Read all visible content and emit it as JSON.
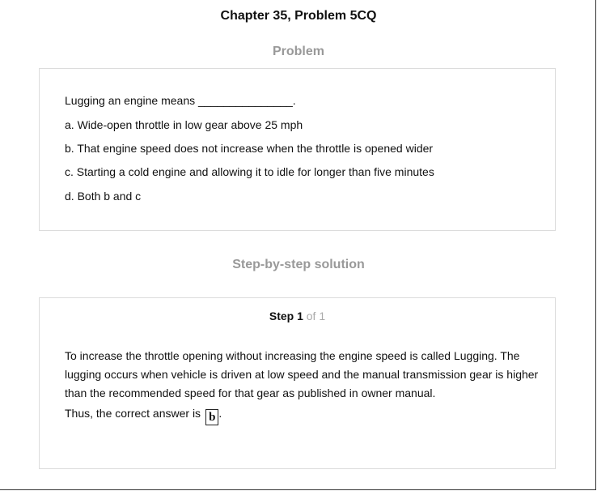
{
  "header": {
    "title": "Chapter 35, Problem 5CQ"
  },
  "problem": {
    "heading": "Problem",
    "question": "Lugging an engine means _______________.",
    "options": [
      "a. Wide-open throttle in low gear above 25 mph",
      "b. That engine speed does not increase when the throttle is opened wider",
      "c. Starting a cold engine and allowing it to idle for longer than five minutes",
      "d. Both b and c"
    ]
  },
  "solution": {
    "heading": "Step-by-step solution",
    "step_word": "Step 1",
    "step_of": "of 1",
    "explanation": "To increase the throttle opening without increasing the engine speed is called Lugging. The lugging occurs when vehicle is driven at low speed and the manual transmission gear is higher than the recommended speed for that gear as published in owner manual.",
    "answer_prefix": "Thus, the correct answer is",
    "answer": "b",
    "answer_suffix": "."
  }
}
